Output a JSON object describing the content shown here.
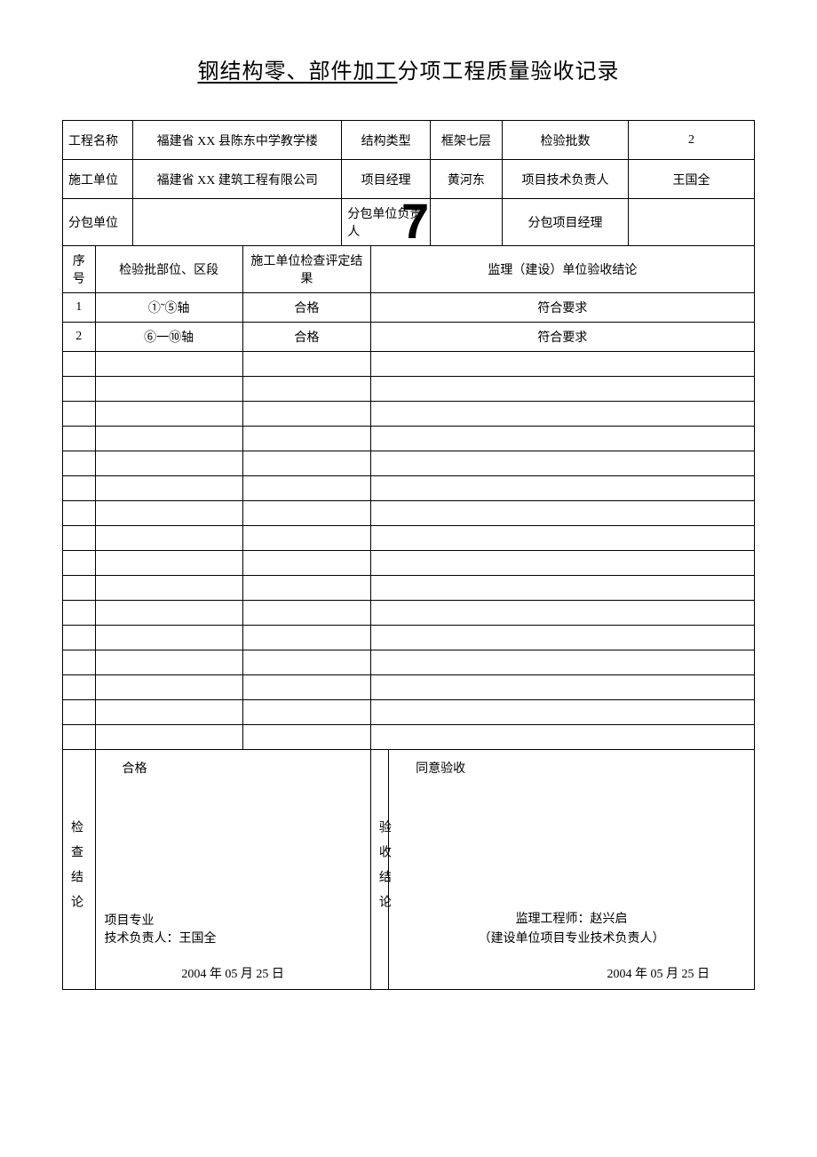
{
  "title": {
    "underlined": "钢结构零、部件加工",
    "rest": "分项工程质量验收记录"
  },
  "watermark": "7",
  "header": {
    "project_name_label": "工程名称",
    "project_name": "福建省 XX 县陈东中学教学楼",
    "structure_type_label": "结构类型",
    "structure_type": "框架七层",
    "inspection_batch_label": "检验批数",
    "inspection_batch": "2",
    "construction_unit_label": "施工单位",
    "construction_unit": "福建省 XX 建筑工程有限公司",
    "project_manager_label": "项目经理",
    "project_manager": "黄河东",
    "tech_lead_label": "项目技术负责人",
    "tech_lead": "王国全",
    "subcontract_unit_label": "分包单位",
    "subcontract_unit": "",
    "subcontract_lead_label": "分包单位负责人",
    "subcontract_lead": "",
    "subcontract_pm_label": "分包项目经理",
    "subcontract_pm": ""
  },
  "columns": {
    "seq": "序号",
    "location": "检验批部位、区段",
    "construction_result": "施工单位检查评定结果",
    "supervision_result": "监理（建设）单位验收结论"
  },
  "rows": [
    {
      "seq": "1",
      "location": "①˜⑤轴",
      "construction_result": "合格",
      "supervision_result": "符合要求"
    },
    {
      "seq": "2",
      "location": "⑥一⑩轴",
      "construction_result": "合格",
      "supervision_result": "符合要求"
    },
    {
      "seq": "",
      "location": "",
      "construction_result": "",
      "supervision_result": ""
    },
    {
      "seq": "",
      "location": "",
      "construction_result": "",
      "supervision_result": ""
    },
    {
      "seq": "",
      "location": "",
      "construction_result": "",
      "supervision_result": ""
    },
    {
      "seq": "",
      "location": "",
      "construction_result": "",
      "supervision_result": ""
    },
    {
      "seq": "",
      "location": "",
      "construction_result": "",
      "supervision_result": ""
    },
    {
      "seq": "",
      "location": "",
      "construction_result": "",
      "supervision_result": ""
    },
    {
      "seq": "",
      "location": "",
      "construction_result": "",
      "supervision_result": ""
    },
    {
      "seq": "",
      "location": "",
      "construction_result": "",
      "supervision_result": ""
    },
    {
      "seq": "",
      "location": "",
      "construction_result": "",
      "supervision_result": ""
    },
    {
      "seq": "",
      "location": "",
      "construction_result": "",
      "supervision_result": ""
    },
    {
      "seq": "",
      "location": "",
      "construction_result": "",
      "supervision_result": ""
    },
    {
      "seq": "",
      "location": "",
      "construction_result": "",
      "supervision_result": ""
    },
    {
      "seq": "",
      "location": "",
      "construction_result": "",
      "supervision_result": ""
    },
    {
      "seq": "",
      "location": "",
      "construction_result": "",
      "supervision_result": ""
    },
    {
      "seq": "",
      "location": "",
      "construction_result": "",
      "supervision_result": ""
    },
    {
      "seq": "",
      "location": "",
      "construction_result": "",
      "supervision_result": ""
    }
  ],
  "conclusion": {
    "check_label": "检查结论",
    "check_result": "合格",
    "check_signer_line1": "项目专业",
    "check_signer_line2": "技术负责人：王国全",
    "check_date": "2004 年 05 月 25 日",
    "accept_label": "验收结论",
    "accept_result": "同意验收",
    "accept_signer_line1": "监理工程师：赵兴启",
    "accept_signer_line2": "（建设单位项目专业技术负责人）",
    "accept_date": "2004 年 05 月 25 日"
  }
}
